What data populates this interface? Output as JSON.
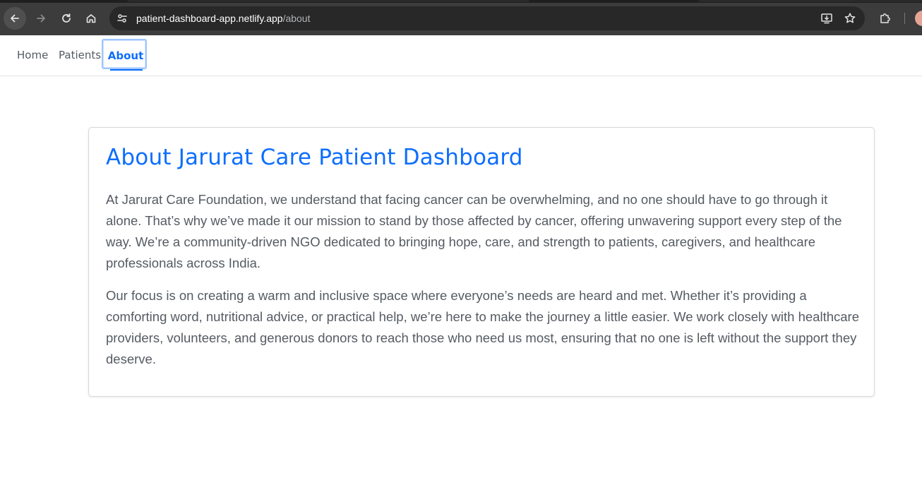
{
  "browser": {
    "url_host": "patient-dashboard-app.netlify.app",
    "url_path": "/about"
  },
  "navbar": {
    "links": [
      "Home",
      "Patients",
      "About"
    ],
    "active": "About"
  },
  "main": {
    "title": "About Jarurat Care Patient Dashboard",
    "paragraphs": [
      "At Jarurat Care Foundation, we understand that facing cancer can be overwhelming, and no one should have to go through it alone. That’s why we’ve made it our mission to stand by those affected by cancer, offering unwavering support every step of the way. We’re a community-driven NGO dedicated to bringing hope, care, and strength to patients, caregivers, and healthcare professionals across India.",
      "Our focus is on creating a warm and inclusive space where everyone’s needs are heard and met. Whether it’s providing a comforting word, nutritional advice, or practical help, we’re here to make the journey a little easier. We work closely with healthcare providers, volunteers, and generous donors to reach those who need us most, ensuring that no one is left without the support they deserve."
    ]
  },
  "colors": {
    "accent": "#0d6efd",
    "body_text": "#555b62",
    "chrome_bg": "#3c3c3c"
  },
  "icons": {
    "back": "arrow-left-icon",
    "forward": "arrow-right-icon",
    "reload": "reload-icon",
    "home": "home-icon",
    "site_info": "tune-icon",
    "install": "install-app-icon",
    "bookmark": "star-icon",
    "extensions": "puzzle-icon"
  }
}
